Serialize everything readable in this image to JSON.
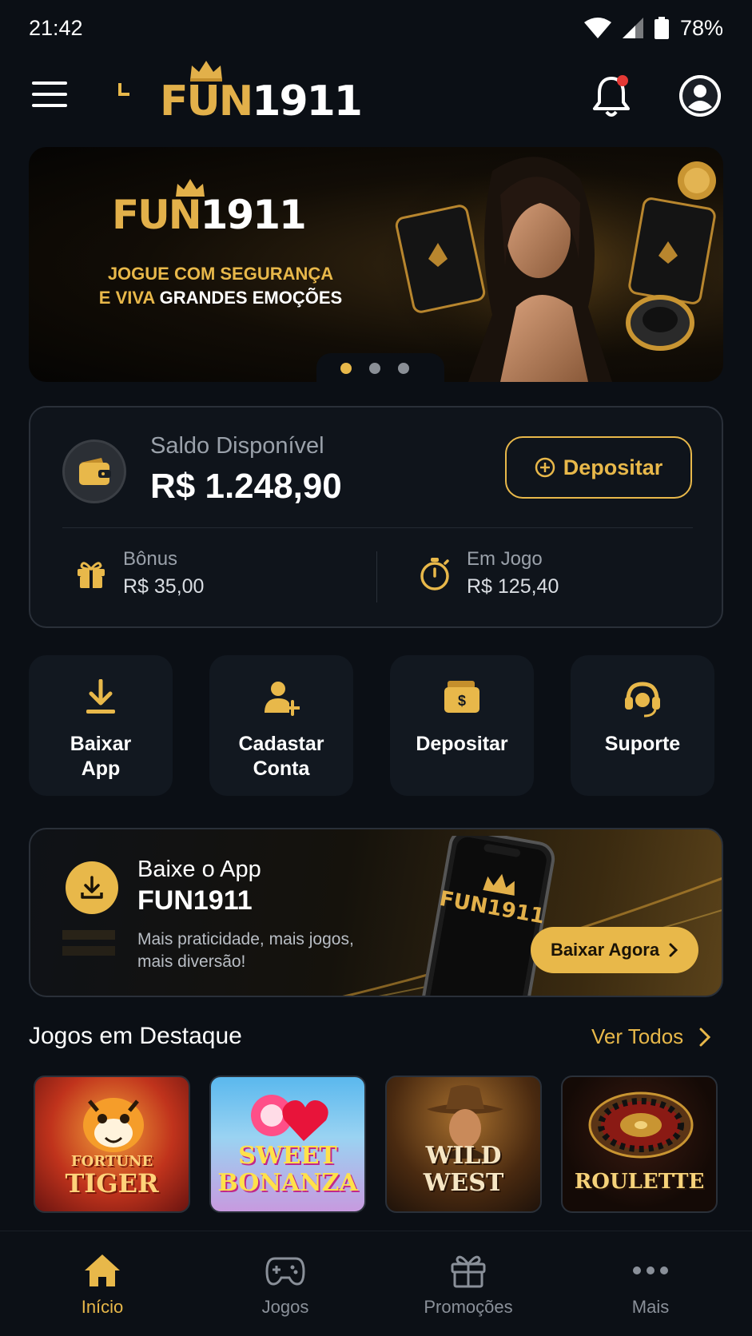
{
  "status_bar": {
    "time": "21:42",
    "battery": "78%"
  },
  "header": {
    "logo_fun": "FUN",
    "logo_num": "1911"
  },
  "banner": {
    "logo_fun": "FUN",
    "logo_num": "1911",
    "line1": "JOGUE COM SEGURANÇA",
    "line2_prefix": "E VIVA ",
    "line2_bold": "GRANDES EMOÇÕES",
    "slides": 3,
    "active_slide": 1
  },
  "balance": {
    "label": "Saldo Disponível",
    "value": "R$ 1.248,90",
    "deposit_label": "Depositar",
    "bonus_label": "Bônus",
    "bonus_value": "R$ 35,00",
    "in_game_label": "Em Jogo",
    "in_game_value": "R$ 125,40"
  },
  "quick_actions": [
    {
      "line1": "Baixar",
      "line2": "App",
      "icon": "download-icon"
    },
    {
      "line1": "Cadastar",
      "line2": "Conta",
      "icon": "add-user-icon"
    },
    {
      "line1": "Depositar",
      "line2": "",
      "icon": "wallet-deposit-icon"
    },
    {
      "line1": "Suporte",
      "line2": "",
      "icon": "headset-icon"
    }
  ],
  "app_promo": {
    "title": "Baixe o App",
    "brand": "FUN1911",
    "subtitle": "Mais praticidade, mais jogos, mais diversão!",
    "phone_logo": "FUN1911",
    "button": "Baixar Agora"
  },
  "featured": {
    "title": "Jogos em Destaque",
    "see_all": "Ver Todos",
    "games": [
      {
        "line1": "FORTUNE",
        "line2": "TIGER"
      },
      {
        "line1": "SWEET",
        "line2": "BONANZA"
      },
      {
        "line1": "WILD",
        "line2": "WEST"
      },
      {
        "line1": "ROULETTE",
        "line2": ""
      }
    ]
  },
  "bottom_nav": [
    {
      "label": "Início",
      "active": true
    },
    {
      "label": "Jogos",
      "active": false
    },
    {
      "label": "Promoções",
      "active": false
    },
    {
      "label": "Mais",
      "active": false
    }
  ],
  "colors": {
    "accent": "#e8b84a",
    "background": "#0b0f15",
    "card": "#121820",
    "notification": "#e53935"
  }
}
